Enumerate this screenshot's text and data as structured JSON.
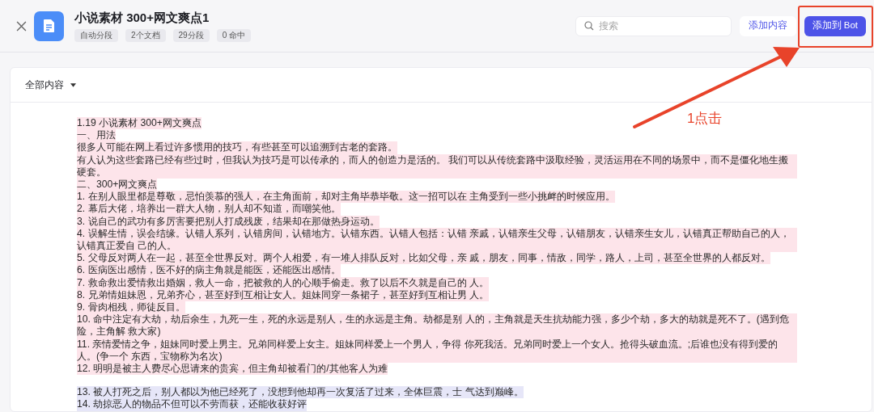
{
  "header": {
    "title": "小说素材 300+网文爽点1",
    "tags": [
      "自动分段",
      "2个文档",
      "29分段",
      "0 命中"
    ],
    "search": {
      "placeholder": "搜索"
    },
    "buttons": [
      {
        "label": "添加内容",
        "kind": "secondary"
      },
      {
        "label": "添加到 Bot",
        "kind": "primary"
      }
    ]
  },
  "filter": {
    "label": "全部内容"
  },
  "segments": [
    {
      "color": "#fde4ea",
      "paragraphs": [
        "1.19 小说素材 300+网文爽点",
        "一、用法",
        "很多人可能在网上看过许多惯用的技巧，有些甚至可以追溯到古老的套路。",
        "有人认为这些套路已经有些过时，但我认为技巧是可以传承的，而人的创造力是活的。 我们可以从传统套路中汲取经验，灵活运用在不同的场景中，而不是僵化地生搬硬套。",
        "二、300+网文爽点",
        "1. 在别人眼里都是尊敬，忌怕羡慕的强人，在主角面前，却对主角毕恭毕敬。这一招可以在 主角受到一些小挑衅的时候应用。",
        "2. 幕后大佬，培养出一群大人物，别人却不知道，而嘲笑他。",
        "3. 说自己的武功有多厉害要把别人打成残废，结果却在那做热身运动。",
        "4. 误解生情，误会结缘。认错人系列，认错房间，认错地方。认错东西。认错人包括：认错 亲戚，认错亲生父母，认错朋友，认错亲生女儿，认错真正帮助自己的人，认错真正爱自 己的人。",
        "5. 父母反对两人在一起，甚至全世界反对。两个人相爱，有一堆人排队反对，比如父母，亲 戚，朋友，同事，情敌，同学，路人，上司，甚至全世界的人都反对。",
        "6. 医病医出感情，医不好的病主角就是能医，还能医出感情。",
        "7. 救命救出爱情救出婚姻，救人一命，把被救的人的心顺手偷走。救了以后不久就是自己的 人。",
        "8. 兄弟情姐妹恩，兄弟齐心，甚至好到互相让女人。姐妹同穿一条裙子，甚至好到互相让男 人。",
        "9. 骨肉相残，师徒反目。",
        "10. 命中注定有大劫，劫后余生，九死一生，死的永远是别人，生的永远是主角。劫都是别 人的，主角就是天生抗劫能力强，多少个劫，多大的劫就是死不了。(遇到危险，主角解 救大家)",
        "11. 亲情爱情之争，姐妹同时爱上男主。兄弟同样爱上女主。姐妹同样爱上一个男人，争得 你死我活。兄弟同时爱上一个女人。抢得头破血流。;后谁也没有得到爱的人。(争一个 东西，宝物称为名次)",
        "12. 明明是被主人费尽心思请来的贵宾，但主角却被看门的/其他客人为难"
      ]
    },
    {
      "color": "#e6e6f8",
      "paragraphs": [
        "13. 被人打死之后，别人都以为他已经死了，没想到他却再一次复活了过来，全体巨震，士 气达到巅峰。",
        "14. 劫掠恶人的物品不但可以不劳而获，还能收获好评"
      ]
    }
  ],
  "annotation": {
    "label": "1点击"
  }
}
